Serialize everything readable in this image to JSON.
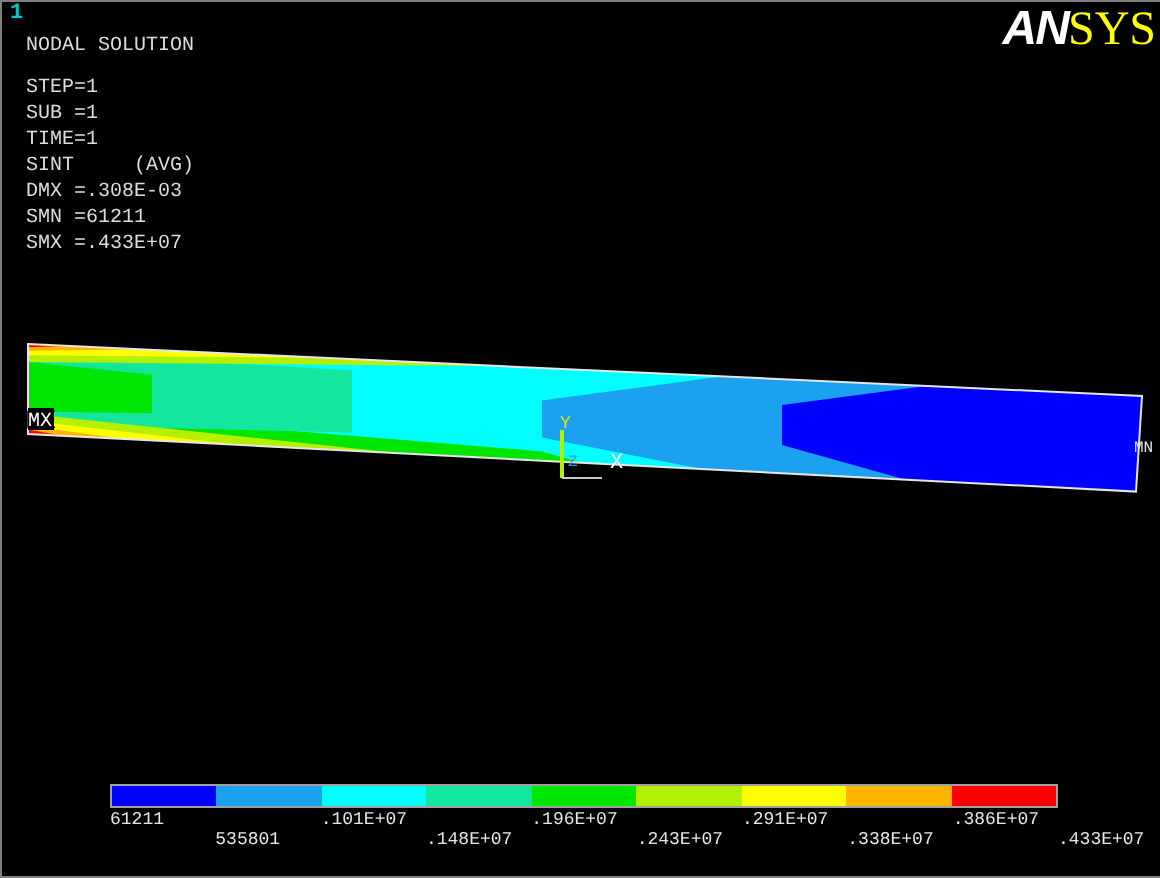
{
  "window_number": "1",
  "title": "NODAL SOLUTION",
  "info_lines": [
    "STEP=1",
    "SUB =1",
    "TIME=1",
    "SINT     (AVG)",
    "DMX =.308E-03",
    "SMN =61211",
    "SMX =.433E+07"
  ],
  "logo": {
    "part_1": "AN",
    "part_2": "SYS"
  },
  "plot": {
    "max_label": "MX",
    "min_label": "MN",
    "axes": [
      "Y",
      "X",
      "Z"
    ]
  },
  "legend": {
    "bands": [
      {
        "color": "#0000ff"
      },
      {
        "color": "#1ca0f0"
      },
      {
        "color": "#00ffff"
      },
      {
        "color": "#14e6a0"
      },
      {
        "color": "#00e600"
      },
      {
        "color": "#b4f000"
      },
      {
        "color": "#ffff00"
      },
      {
        "color": "#ffb400"
      },
      {
        "color": "#ff0000"
      }
    ],
    "labels": [
      "61211",
      "535801",
      ".101E+07",
      ".148E+07",
      ".196E+07",
      ".243E+07",
      ".291E+07",
      ".338E+07",
      ".386E+07",
      ".433E+07"
    ]
  }
}
